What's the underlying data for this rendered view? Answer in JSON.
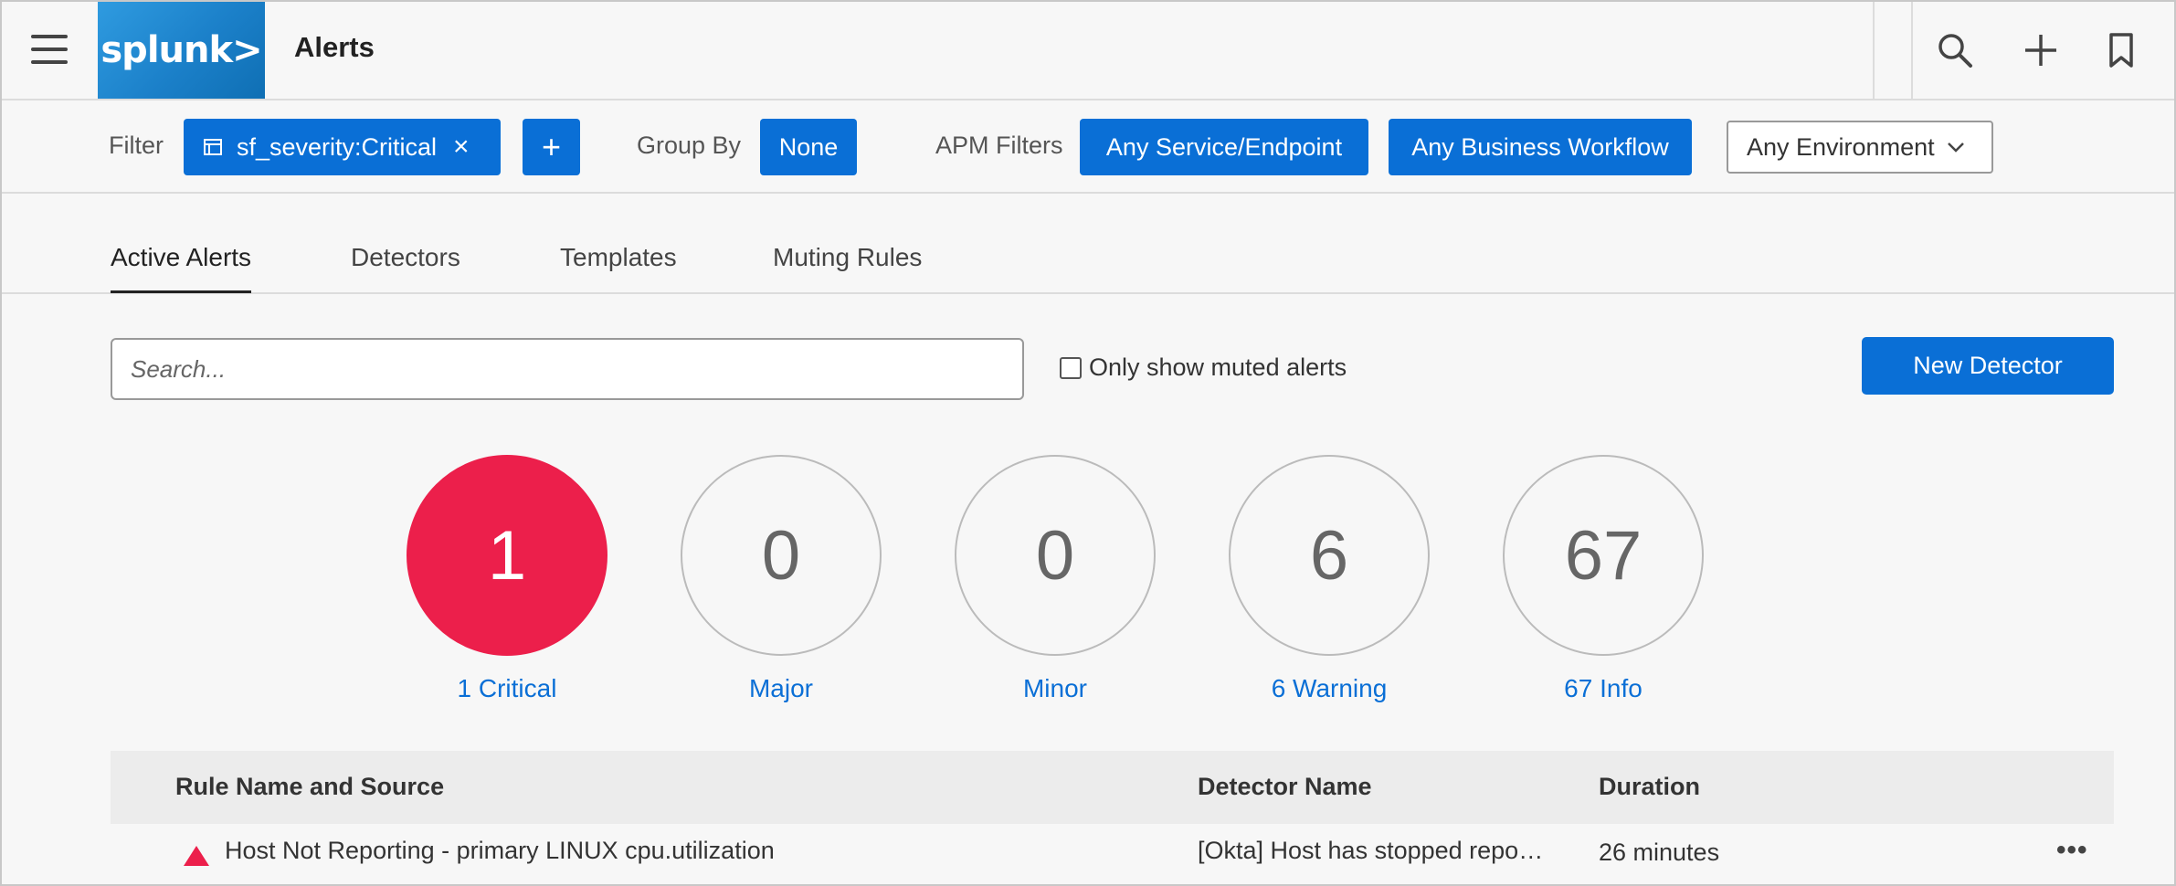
{
  "app": {
    "logo_text": "splunk>",
    "title": "Alerts"
  },
  "header_icons": [
    "search-icon",
    "plus-icon",
    "bookmark-icon"
  ],
  "filterbar": {
    "filter_label": "Filter",
    "filter_chip": "sf_severity:Critical",
    "filter_chip_close": "×",
    "add_filter": "+",
    "group_by_label": "Group By",
    "group_by_value": "None",
    "apm_label": "APM Filters",
    "apm_service": "Any Service/Endpoint",
    "apm_workflow": "Any Business Workflow",
    "environment": "Any Environment"
  },
  "tabs": [
    {
      "label": "Active Alerts",
      "active": true
    },
    {
      "label": "Detectors",
      "active": false
    },
    {
      "label": "Templates",
      "active": false
    },
    {
      "label": "Muting Rules",
      "active": false
    }
  ],
  "search": {
    "placeholder": "Search...",
    "muted_label": "Only show muted alerts",
    "new_detector": "New Detector"
  },
  "severity": [
    {
      "count": "1",
      "label": "1 Critical",
      "color": "#ec1f4b"
    },
    {
      "count": "0",
      "label": "Major"
    },
    {
      "count": "0",
      "label": "Minor"
    },
    {
      "count": "6",
      "label": "6 Warning"
    },
    {
      "count": "67",
      "label": "67 Info"
    }
  ],
  "table": {
    "headers": [
      "Rule Name and Source",
      "Detector Name",
      "Duration"
    ],
    "rows": [
      {
        "rule": "Host Not Reporting - primary LINUX cpu.utilization",
        "detector": "[Okta] Host has stopped repo…",
        "duration": "26 minutes",
        "more": "•••"
      }
    ]
  },
  "colors": {
    "accent": "#0a6fd6",
    "critical": "#ec1f4b"
  }
}
